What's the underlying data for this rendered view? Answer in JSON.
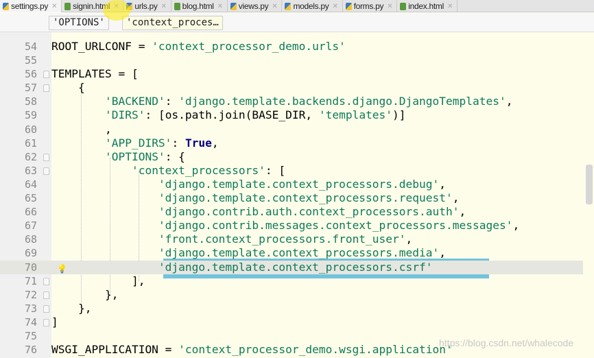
{
  "tabs": [
    {
      "label": "settings.py",
      "type": "py",
      "active": true
    },
    {
      "label": "signin.html",
      "type": "html"
    },
    {
      "label": "urls.py",
      "type": "py"
    },
    {
      "label": "blog.html",
      "type": "html"
    },
    {
      "label": "views.py",
      "type": "py"
    },
    {
      "label": "models.py",
      "type": "py"
    },
    {
      "label": "forms.py",
      "type": "py"
    },
    {
      "label": "index.html",
      "type": "html"
    }
  ],
  "breadcrumbs": [
    "'OPTIONS'",
    "'context_proces…"
  ],
  "current_line": 70,
  "lines": [
    {
      "n": 54,
      "t": [
        [
          "",
          "ROOT_URLCONF = "
        ],
        [
          "str",
          "'context_processor_demo.urls'"
        ]
      ]
    },
    {
      "n": 55,
      "t": []
    },
    {
      "n": 56,
      "t": [
        [
          "",
          "TEMPLATES = ["
        ]
      ],
      "fold": true
    },
    {
      "n": 57,
      "t": [
        [
          "",
          "    {"
        ]
      ],
      "fold": true
    },
    {
      "n": 58,
      "t": [
        [
          "",
          "        "
        ],
        [
          "str",
          "'BACKEND'"
        ],
        [
          "",
          ": "
        ],
        [
          "str",
          "'django.template.backends.django.DjangoTemplates'"
        ],
        [
          "",
          ","
        ]
      ]
    },
    {
      "n": 59,
      "t": [
        [
          "",
          "        "
        ],
        [
          "str",
          "'DIRS'"
        ],
        [
          "",
          ": [os.path.join(BASE_DIR, "
        ],
        [
          "str",
          "'templates'"
        ],
        [
          "",
          ")]"
        ]
      ]
    },
    {
      "n": 60,
      "t": [
        [
          "",
          "        ,"
        ]
      ]
    },
    {
      "n": 61,
      "t": [
        [
          "",
          "        "
        ],
        [
          "str",
          "'APP_DIRS'"
        ],
        [
          "",
          ": "
        ],
        [
          "bold",
          "True"
        ],
        [
          "",
          ","
        ]
      ]
    },
    {
      "n": 62,
      "t": [
        [
          "",
          "        "
        ],
        [
          "str",
          "'OPTIONS'"
        ],
        [
          "",
          ": {"
        ]
      ],
      "fold": true
    },
    {
      "n": 63,
      "t": [
        [
          "",
          "            "
        ],
        [
          "str",
          "'context_processors'"
        ],
        [
          "",
          ": ["
        ]
      ],
      "fold": true
    },
    {
      "n": 64,
      "t": [
        [
          "",
          "                "
        ],
        [
          "str",
          "'django.template.context_processors.debug'"
        ],
        [
          "",
          ","
        ]
      ]
    },
    {
      "n": 65,
      "t": [
        [
          "",
          "                "
        ],
        [
          "str",
          "'django.template.context_processors.request'"
        ],
        [
          "",
          ","
        ]
      ]
    },
    {
      "n": 66,
      "t": [
        [
          "",
          "                "
        ],
        [
          "str",
          "'django.contrib.auth.context_processors.auth'"
        ],
        [
          "",
          ","
        ]
      ]
    },
    {
      "n": 67,
      "t": [
        [
          "",
          "                "
        ],
        [
          "str",
          "'django.contrib.messages.context_processors.messages'"
        ],
        [
          "",
          ","
        ]
      ]
    },
    {
      "n": 68,
      "t": [
        [
          "",
          "                "
        ],
        [
          "str",
          "'front.context_processors.front_user'"
        ],
        [
          "",
          ","
        ]
      ]
    },
    {
      "n": 69,
      "t": [
        [
          "",
          "                "
        ],
        [
          "str",
          "'django.template.context_processors.media'"
        ],
        [
          "",
          ","
        ]
      ]
    },
    {
      "n": 70,
      "t": [
        [
          "",
          "                "
        ],
        [
          "str",
          "'django.template.context_processors.csrf'"
        ]
      ],
      "bulb": true
    },
    {
      "n": 71,
      "t": [
        [
          "",
          "            ],"
        ]
      ],
      "fold": true
    },
    {
      "n": 72,
      "t": [
        [
          "",
          "        },"
        ]
      ],
      "fold": true
    },
    {
      "n": 73,
      "t": [
        [
          "",
          "    },"
        ]
      ],
      "fold": true
    },
    {
      "n": 74,
      "t": [
        [
          "",
          "]"
        ]
      ],
      "fold": true
    },
    {
      "n": 75,
      "t": []
    },
    {
      "n": 76,
      "t": [
        [
          "",
          "WSGI_APPLICATION = "
        ],
        [
          "str",
          "'context_processor_demo.wsgi.application'"
        ]
      ]
    }
  ],
  "watermark": "https://blog.csdn.net/whalecode"
}
